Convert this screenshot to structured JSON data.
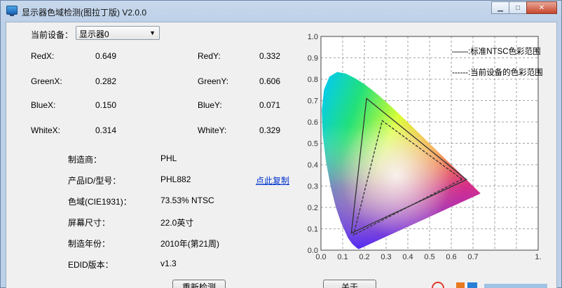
{
  "window": {
    "title": "显示器色域检测(图拉丁版) V2.0.0",
    "minimize": "▁",
    "maximize": "□",
    "close": "✕"
  },
  "device": {
    "label": "当前设备：",
    "selected": "显示器0"
  },
  "chroma": {
    "red_x_label": "RedX:",
    "red_x": "0.649",
    "red_y_label": "RedY:",
    "red_y": "0.332",
    "green_x_label": "GreenX:",
    "green_x": "0.282",
    "green_y_label": "GreenY:",
    "green_y": "0.606",
    "blue_x_label": "BlueX:",
    "blue_x": "0.150",
    "blue_y_label": "BlueY:",
    "blue_y": "0.071",
    "white_x_label": "WhiteX:",
    "white_x": "0.314",
    "white_y_label": "WhiteY:",
    "white_y": "0.329"
  },
  "info": {
    "maker_label": "制造商：",
    "maker": "PHL",
    "product_label": "产品ID/型号：",
    "product": "PHL882",
    "copy_link": "点此复制",
    "gamut_label": "色域(CIE1931)：",
    "gamut": "73.53% NTSC",
    "size_label": "屏幕尺寸：",
    "size": "22.0英寸",
    "year_label": "制造年份：",
    "year": "2010年(第21周)",
    "edid_label": "EDID版本：",
    "edid": "v1.3"
  },
  "buttons": {
    "redetect": "重新检测",
    "about": "关于"
  },
  "colors": {
    "titlebar": "#bcd0e8",
    "client_bg": "#f0f0f0",
    "link": "#0033cc"
  },
  "chart_data": {
    "type": "scatter",
    "xlim": [
      0,
      1.0
    ],
    "ylim": [
      0,
      1.0
    ],
    "x_ticks": [
      "0.0",
      "0.1",
      "0.2",
      "0.3",
      "0.4",
      "0.5",
      "0.6",
      "0.7",
      "1."
    ],
    "y_ticks": [
      "0.0",
      "0.1",
      "0.2",
      "0.3",
      "0.4",
      "0.5",
      "0.6",
      "0.7",
      "0.8",
      "0.9",
      "1.0"
    ],
    "grid": true,
    "legend_position": "top-right",
    "series": [
      {
        "name": "标准NTSC色彩范围",
        "legend_text": "——:标准NTSC色彩范围",
        "style": "solid",
        "points": [
          [
            0.67,
            0.33
          ],
          [
            0.21,
            0.71
          ],
          [
            0.14,
            0.08
          ]
        ]
      },
      {
        "name": "当前设备的色彩范围",
        "legend_text": "------:当前设备的色彩范围",
        "style": "dashed",
        "points": [
          [
            0.649,
            0.332
          ],
          [
            0.282,
            0.606
          ],
          [
            0.15,
            0.071
          ]
        ]
      }
    ],
    "spectral_locus": [
      [
        0.1741,
        0.005
      ],
      [
        0.1666,
        0.0089
      ],
      [
        0.144,
        0.0297
      ],
      [
        0.1241,
        0.0578
      ],
      [
        0.0913,
        0.1327
      ],
      [
        0.0687,
        0.2007
      ],
      [
        0.0454,
        0.295
      ],
      [
        0.0235,
        0.4127
      ],
      [
        0.0082,
        0.5384
      ],
      [
        0.0039,
        0.6548
      ],
      [
        0.0139,
        0.7502
      ],
      [
        0.0389,
        0.812
      ],
      [
        0.0743,
        0.8338
      ],
      [
        0.1142,
        0.8262
      ],
      [
        0.1547,
        0.8059
      ],
      [
        0.1929,
        0.7816
      ],
      [
        0.2296,
        0.7543
      ],
      [
        0.2658,
        0.7243
      ],
      [
        0.3016,
        0.6923
      ],
      [
        0.3373,
        0.6589
      ],
      [
        0.3731,
        0.6245
      ],
      [
        0.4087,
        0.5896
      ],
      [
        0.4441,
        0.5547
      ],
      [
        0.4788,
        0.5202
      ],
      [
        0.5125,
        0.4866
      ],
      [
        0.5448,
        0.4544
      ],
      [
        0.5752,
        0.4242
      ],
      [
        0.6029,
        0.3965
      ],
      [
        0.627,
        0.3725
      ],
      [
        0.6482,
        0.3514
      ],
      [
        0.6658,
        0.334
      ],
      [
        0.6801,
        0.3197
      ],
      [
        0.6915,
        0.3083
      ],
      [
        0.7006,
        0.2993
      ],
      [
        0.7347,
        0.2653
      ]
    ]
  }
}
